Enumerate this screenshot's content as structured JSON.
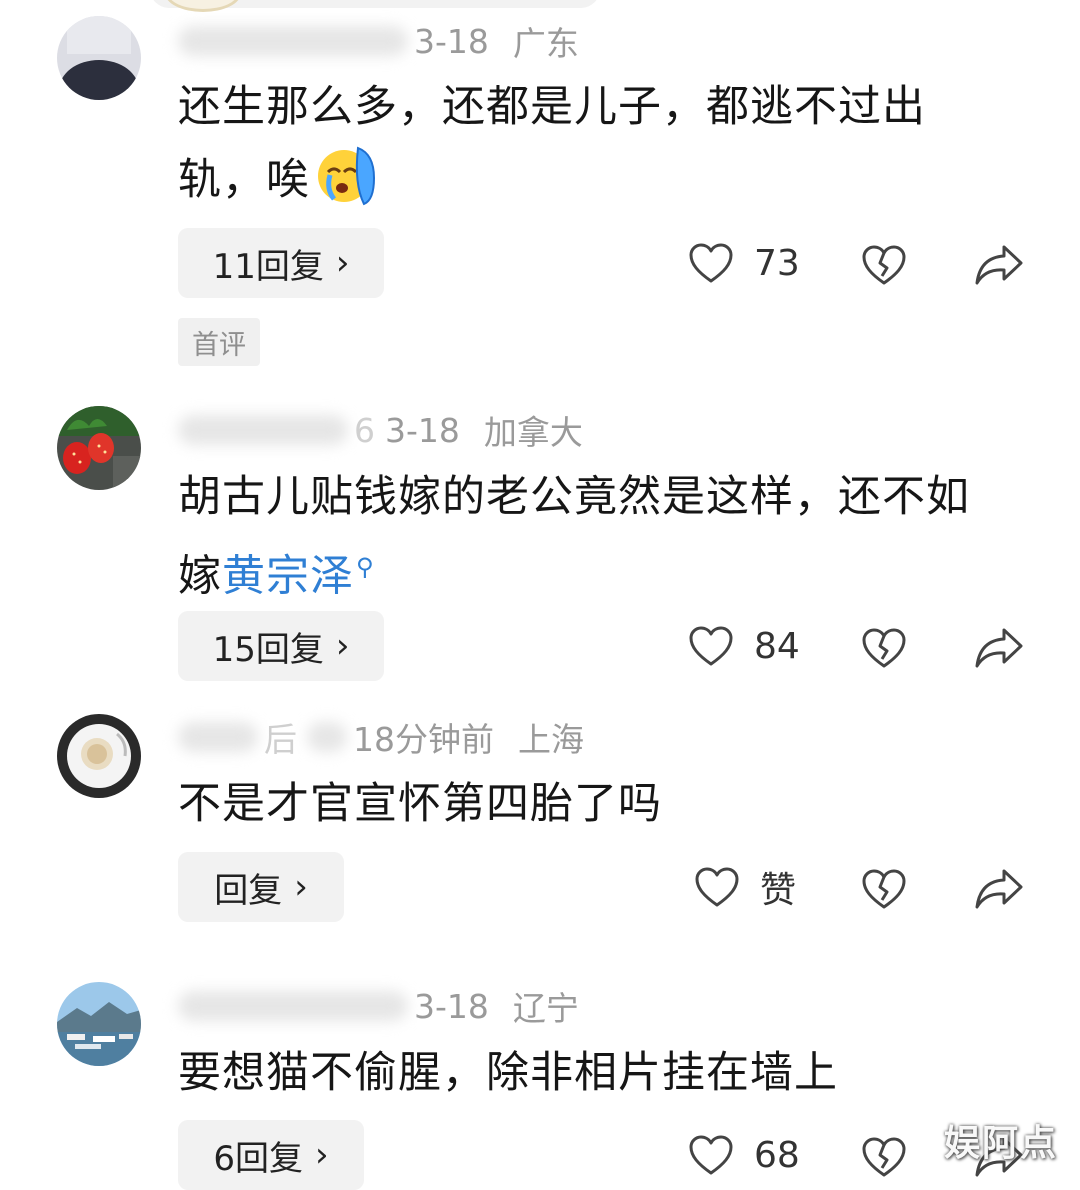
{
  "comments": [
    {
      "name_tail": "",
      "date": "3-18",
      "location": "广东",
      "text": "还生那么多，还都是儿子，都逃不过出轨，唉",
      "emoji": "crying-face-emoji",
      "replies": "11回复",
      "likes": "73",
      "badge": "首评"
    },
    {
      "name_tail": "6",
      "date": "3-18",
      "location": "加拿大",
      "text_before": "胡古儿贴钱嫁的老公竟然是这样，还不如嫁",
      "link": "黄宗泽",
      "replies": "15回复",
      "likes": "84"
    },
    {
      "name_tail": "后",
      "date": "18分钟前",
      "location": "上海",
      "text": "不是才官宣怀第四胎了吗",
      "replies": "回复",
      "likes": "赞"
    },
    {
      "name_tail": "",
      "date": "3-18",
      "location": "辽宁",
      "text": "要想猫不偷腥，除非相片挂在墙上",
      "replies": "6回复",
      "likes": "68"
    }
  ],
  "icons": {
    "chevron": "›",
    "like": "heart-outline-icon",
    "dislike": "broken-heart-icon",
    "share": "share-arrow-icon",
    "search": "search-icon"
  },
  "colors": {
    "link": "#2f7fd4",
    "meta": "#9a9a9a",
    "button_bg": "#f2f2f2"
  },
  "watermark": "娱阿点"
}
